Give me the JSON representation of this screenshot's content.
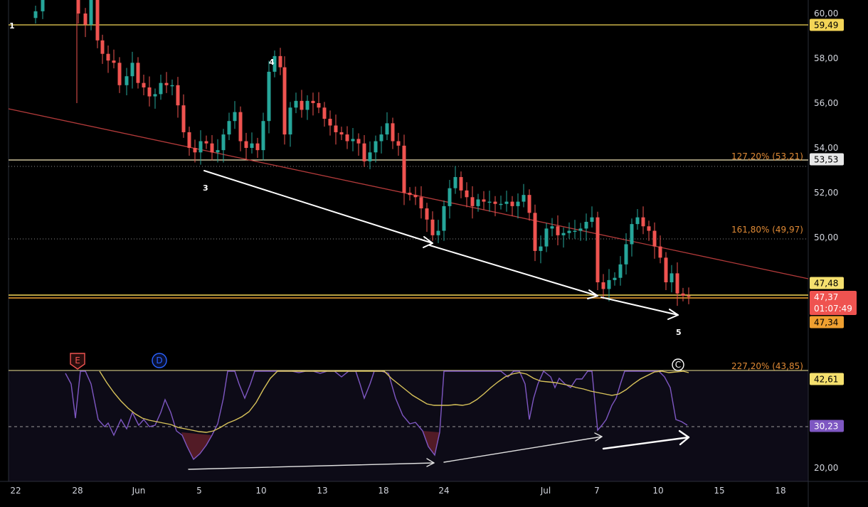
{
  "chart_data": {
    "type": "candlestick",
    "price_axis": {
      "ticks": [
        "60,00",
        "58,00",
        "56,00",
        "54,00",
        "52,00",
        "50,00"
      ],
      "tick_values": [
        60,
        58,
        56,
        54,
        52,
        50
      ],
      "ylim": [
        44.3,
        60.6
      ]
    },
    "oscillator_axis": {
      "ticks": [
        "20,00"
      ],
      "tick_values": [
        20
      ]
    },
    "time_axis": {
      "labels": [
        "22",
        "28",
        "Jun",
        "5",
        "10",
        "13",
        "18",
        "24",
        "Jul",
        "7",
        "10",
        "15",
        "18"
      ]
    },
    "price_tags": [
      {
        "text": "59,49",
        "value": 59.49,
        "bg": "#f3d557",
        "fg": "#000000"
      },
      {
        "text": "53,53",
        "value": 53.53,
        "bg": "#e8e8e8",
        "fg": "#000000"
      },
      {
        "text": "47,48",
        "value": 47.48,
        "bg": "#f5e06e",
        "fg": "#000000"
      },
      {
        "text": "47,37",
        "value": 47.37,
        "bg": "#ef5350",
        "fg": "#ffffff",
        "sub": "01:07:49"
      },
      {
        "text": "47,34",
        "value": 47.34,
        "bg": "#f0a030",
        "fg": "#000000"
      }
    ],
    "oscillator_tags": [
      {
        "text": "42,61",
        "value": 42.61,
        "bg": "#f5e06e",
        "fg": "#000000"
      },
      {
        "text": "30,23",
        "value": 30.23,
        "bg": "#7e57c2",
        "fg": "#ffffff"
      }
    ],
    "fib_levels": [
      {
        "label": "127,20% (53,21)",
        "value": 53.53
      },
      {
        "label": "161,80% (49,97)",
        "value": 49.97
      },
      {
        "label": "227,20% (43,85)",
        "value": 43.85
      }
    ],
    "wave_labels": [
      "1",
      "3",
      "4",
      "5"
    ],
    "event_markers": [
      {
        "text": "E",
        "color": "#ef5350"
      },
      {
        "text": "D",
        "color": "#2962ff"
      },
      {
        "text": "C",
        "color": "#ffffff"
      }
    ],
    "colors": {
      "up": "#26a69a",
      "down": "#ef5350",
      "horizontal_line": "#f3d557",
      "trendline": "#b23a3a",
      "fib": "#e08a35",
      "rsi": "#7e57c2",
      "rsi_ma": "#d8c35a"
    }
  }
}
